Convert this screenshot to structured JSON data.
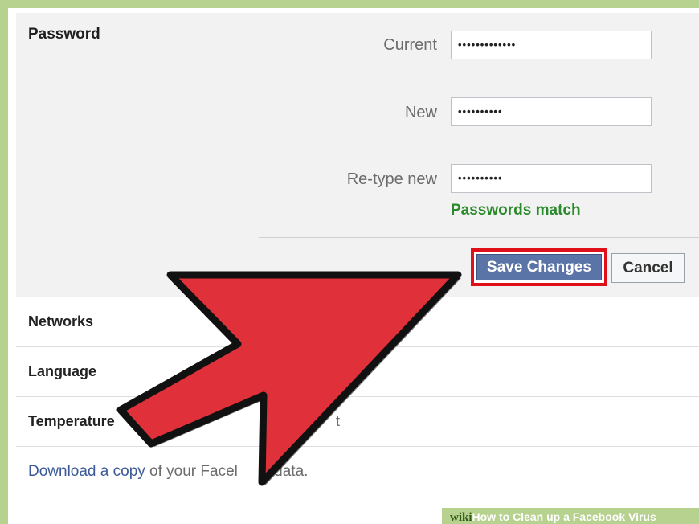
{
  "password_section": {
    "title": "Password",
    "fields": [
      {
        "label": "Current",
        "value": "•••••••••••••"
      },
      {
        "label": "New",
        "value": "••••••••••"
      },
      {
        "label": "Re-type new",
        "value": "••••••••••"
      }
    ],
    "match_status": "Passwords match",
    "save_label": "Save Changes",
    "cancel_label": "Cancel"
  },
  "settings_rows": [
    {
      "label": "Networks",
      "value": ""
    },
    {
      "label": "Language",
      "value": ""
    },
    {
      "label": "Temperature",
      "value": "t"
    }
  ],
  "footer": {
    "link_text": "Download a copy",
    "text_before": "of your Facel",
    "text_after": "data."
  },
  "watermark": {
    "brand": "wiki",
    "how": "How",
    "title": " to Clean up a Facebook Virus"
  },
  "colors": {
    "accent": "#5b74a8",
    "highlight": "#e0101a",
    "arrow": "#e0303a",
    "success": "#2b8a2b",
    "frame": "#b7d18f"
  }
}
